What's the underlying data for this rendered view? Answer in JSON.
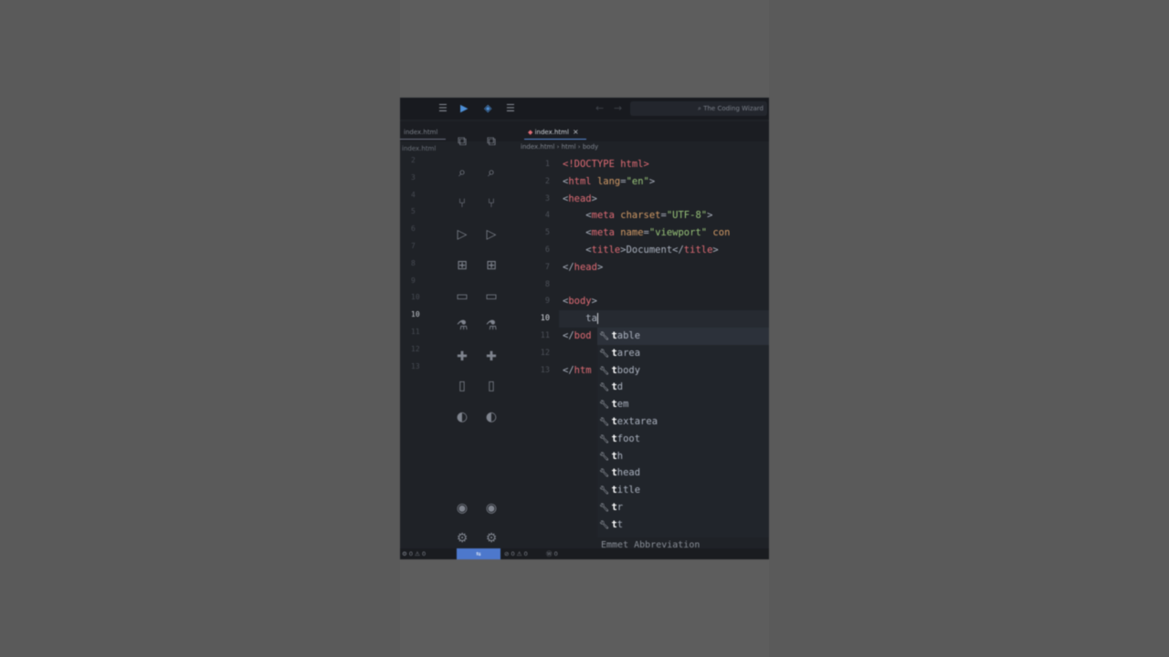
{
  "titlebar": {
    "search_text": "The Coding Wizard"
  },
  "tabs": [
    {
      "label": "index.html",
      "close": "×"
    }
  ],
  "ghost_tab": {
    "label": "index.html"
  },
  "breadcrumb": {
    "file": "index.html",
    "sep1": "›",
    "node1": "html",
    "sep2": "›",
    "node2": "body"
  },
  "editor": {
    "current_line": 10,
    "lines": [
      {
        "num": "1"
      },
      {
        "num": "2"
      },
      {
        "num": "3"
      },
      {
        "num": "4"
      },
      {
        "num": "5"
      },
      {
        "num": "6"
      },
      {
        "num": "7"
      },
      {
        "num": "8"
      },
      {
        "num": "9"
      },
      {
        "num": "10"
      },
      {
        "num": "11"
      },
      {
        "num": "12"
      },
      {
        "num": "13"
      }
    ],
    "code": {
      "l1": "<!DOCTYPE html>",
      "l2_tag": "html",
      "l2_attr": "lang",
      "l2_val": "\"en\"",
      "l3": "head",
      "l4_tag": "meta",
      "l4_attr": "charset",
      "l4_val": "\"UTF-8\"",
      "l5_tag": "meta",
      "l5_attr": "name",
      "l5_val": "\"viewport\"",
      "l5_rest": "con",
      "l6_tag": "title",
      "l6_text": "Document",
      "l7": "head",
      "l9": "body",
      "l10_typed": "ta",
      "l11_partial": "bod",
      "l13_partial": "htm"
    }
  },
  "suggestions": {
    "typed_prefix": "t",
    "items": [
      {
        "hl": "t",
        "rest": "able"
      },
      {
        "hl": "t",
        "rest": "area"
      },
      {
        "hl": "t",
        "rest": "body"
      },
      {
        "hl": "t",
        "rest": "d"
      },
      {
        "hl": "t",
        "rest": "em"
      },
      {
        "hl": "t",
        "rest": "extarea"
      },
      {
        "hl": "t",
        "rest": "foot"
      },
      {
        "hl": "t",
        "rest": "h"
      },
      {
        "hl": "t",
        "rest": "head"
      },
      {
        "hl": "t",
        "rest": "itle"
      },
      {
        "hl": "t",
        "rest": "r"
      },
      {
        "hl": "t",
        "rest": "t"
      }
    ]
  },
  "emmet_hint": "Emmet Abbreviation",
  "statusbar": {
    "left": "⚙ 0 ⚠ 0",
    "remote": "⇆",
    "mid": "⊘ 0 ⚠ 0",
    "right": "Ⓦ 0"
  },
  "icons": {
    "menu": "menu-icon",
    "vscode": "vscode-logo-icon"
  },
  "colors": {
    "accent": "#4d78cc",
    "tag": "#e06c75",
    "attr": "#d19a66",
    "string": "#98c379",
    "background": "#1f2227"
  }
}
